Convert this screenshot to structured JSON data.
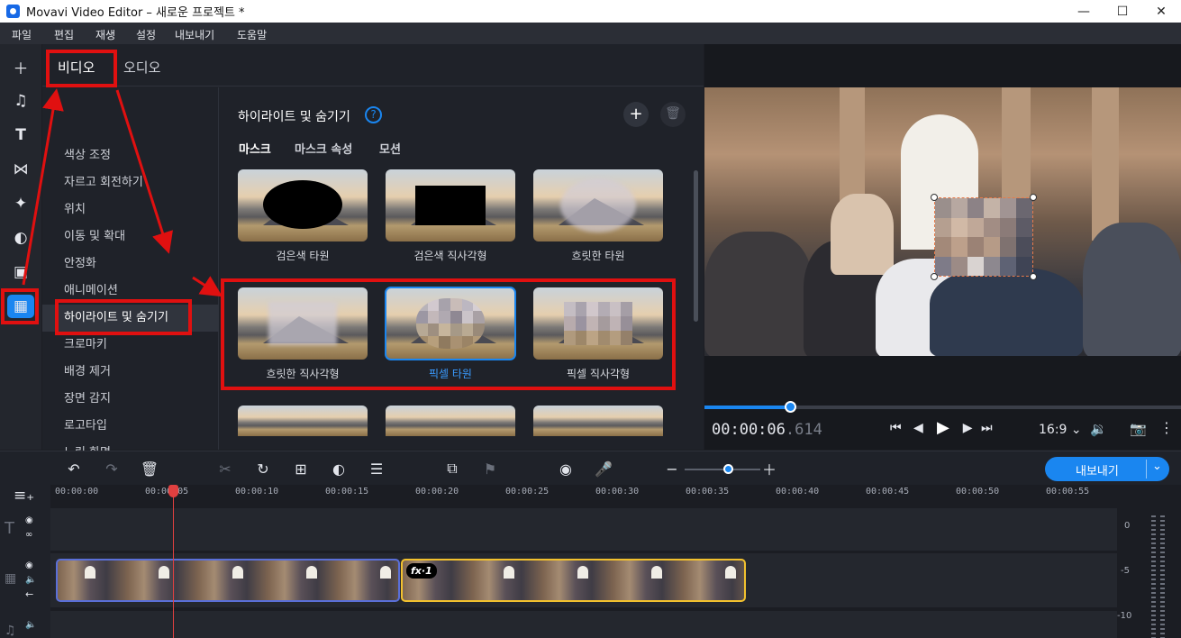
{
  "window": {
    "title": "Movavi Video Editor – 새로운 프로젝트 *",
    "minimize_icon": "minimize-icon",
    "maximize_icon": "maximize-icon",
    "close_icon": "close-icon"
  },
  "menu": [
    "파일",
    "편집",
    "재생",
    "설정",
    "내보내기",
    "도움말"
  ],
  "left_tools": [
    "add-icon",
    "music-icon",
    "text-icon",
    "transition-icon",
    "magic-icon",
    "sticker-icon",
    "toolbox-icon",
    "more-tools-icon"
  ],
  "effects": {
    "tabs": [
      "비디오",
      "오디오"
    ],
    "active_tab": "비디오",
    "categories": [
      "색상 조정",
      "자르고 회전하기",
      "위치",
      "이동 및 확대",
      "안정화",
      "애니메이션",
      "하이라이트 및 숨기기",
      "크로마키",
      "배경 제거",
      "장면 감지",
      "로고타입",
      "느린 화면"
    ],
    "active_category": "하이라이트 및 숨기기",
    "section_title": "하이라이트 및 숨기기",
    "subtabs": [
      "마스크",
      "마스크 속성",
      "모션"
    ],
    "presets": [
      "검은색 타원",
      "검은색 직사각형",
      "흐릿한 타원",
      "흐릿한 직사각형",
      "픽셀 타원",
      "픽셀 직사각형"
    ],
    "selected_preset": "픽셀 타원"
  },
  "preview": {
    "time_main": "00:00:06",
    "time_ms": ".614",
    "aspect": "16:9",
    "playback_position": 0.18
  },
  "timeline_toolbar": {
    "export_label": "내보내기"
  },
  "timeline": {
    "ticks": [
      "00:00:00",
      "00:00:05",
      "00:00:10",
      "00:00:15",
      "00:00:20",
      "00:00:25",
      "00:00:30",
      "00:00:35",
      "00:00:40",
      "00:00:45",
      "00:00:50",
      "00:00:55"
    ],
    "clip_badge": "fx·1",
    "meter_labels": [
      "0",
      "-5",
      "-10"
    ]
  },
  "colors": {
    "accent": "#1a86f0",
    "annotation_red": "#e01010",
    "clip_selected_border": "#f2c12e"
  }
}
